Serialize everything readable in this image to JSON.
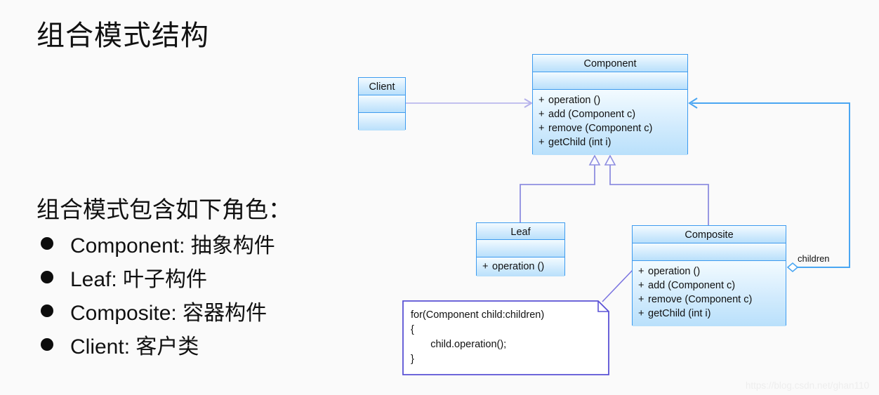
{
  "slide": {
    "title": "组合模式结构",
    "roles_heading": "组合模式包含如下角色：",
    "roles": [
      {
        "label": "Component: 抽象构件"
      },
      {
        "label": "Leaf: 叶子构件"
      },
      {
        "label": "Composite: 容器构件"
      },
      {
        "label": "Client: 客户类"
      }
    ]
  },
  "diagram": {
    "classes": {
      "client": {
        "name": "Client",
        "attributes": [],
        "operations": []
      },
      "component": {
        "name": "Component",
        "attributes": [],
        "operations": [
          {
            "visibility": "+",
            "signature": "operation ()"
          },
          {
            "visibility": "+",
            "signature": "add (Component c)"
          },
          {
            "visibility": "+",
            "signature": "remove (Component c)"
          },
          {
            "visibility": "+",
            "signature": "getChild (int i)"
          }
        ]
      },
      "leaf": {
        "name": "Leaf",
        "attributes": [],
        "operations": [
          {
            "visibility": "+",
            "signature": "operation ()"
          }
        ]
      },
      "composite": {
        "name": "Composite",
        "attributes": [],
        "operations": [
          {
            "visibility": "+",
            "signature": "operation ()"
          },
          {
            "visibility": "+",
            "signature": "add (Component c)"
          },
          {
            "visibility": "+",
            "signature": "remove (Component c)"
          },
          {
            "visibility": "+",
            "signature": "getChild (int i)"
          }
        ]
      }
    },
    "note": {
      "text": "for(Component child:children)\n{\n       child.operation();\n}"
    },
    "association_label": "children",
    "colors": {
      "class_border": "#3d9bef",
      "class_fill_top": "#f3fbff",
      "class_fill_bottom": "#b9e0fb",
      "generalization_line": "#8e8ee0",
      "dependency_line": "#c3c0ef",
      "association_line": "#4aa6f2",
      "note_border": "#5a52d5",
      "background": "#fafafa"
    }
  },
  "watermark": "https://blog.csdn.net/ghan110"
}
